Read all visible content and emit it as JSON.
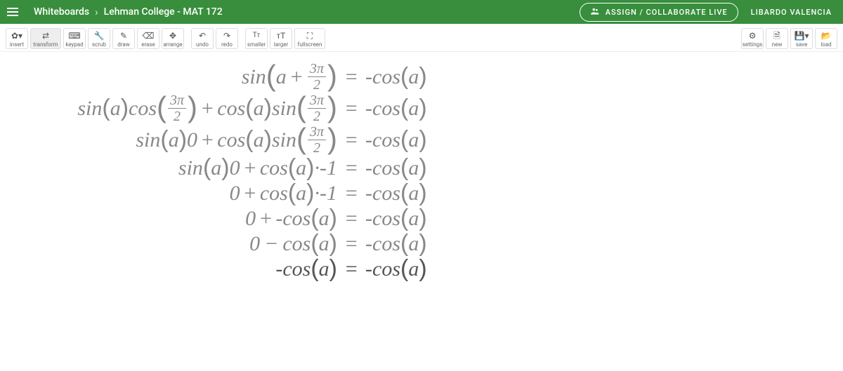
{
  "header": {
    "breadcrumb_root": "Whiteboards",
    "breadcrumb_page": "Lehman College - MAT 172",
    "assign_label": "ASSIGN / COLLABORATE LIVE",
    "user_name": "LIBARDO VALENCIA"
  },
  "toolbar": {
    "insert": "insert",
    "transform": "transform",
    "keypad": "keypad",
    "scrub": "scrub",
    "draw": "draw",
    "erase": "erase",
    "arrange": "arrange",
    "undo": "undo",
    "redo": "redo",
    "smaller": "smaller",
    "larger": "larger",
    "fullscreen": "fullscreen",
    "settings": "settings",
    "new": "new",
    "save": "save",
    "load": "load"
  },
  "math": {
    "sin": "sin",
    "cos": "cos",
    "a": "a",
    "plus": "+",
    "minus": "−",
    "cdotminus1": "·-1",
    "zero": "0",
    "eq": "=",
    "three_pi": "3π",
    "two": "2",
    "neg": "-"
  },
  "equations_description": [
    "sin(a + 3π/2) = -cos(a)",
    "sin(a)cos(3π/2) + cos(a)sin(3π/2) = -cos(a)",
    "sin(a)0 + cos(a)sin(3π/2) = -cos(a)",
    "sin(a)0 + cos(a)·-1 = -cos(a)",
    "0 + cos(a)·-1 = -cos(a)",
    "0 + -cos(a) = -cos(a)",
    "0 − cos(a) = -cos(a)",
    "-cos(a) = -cos(a)"
  ]
}
